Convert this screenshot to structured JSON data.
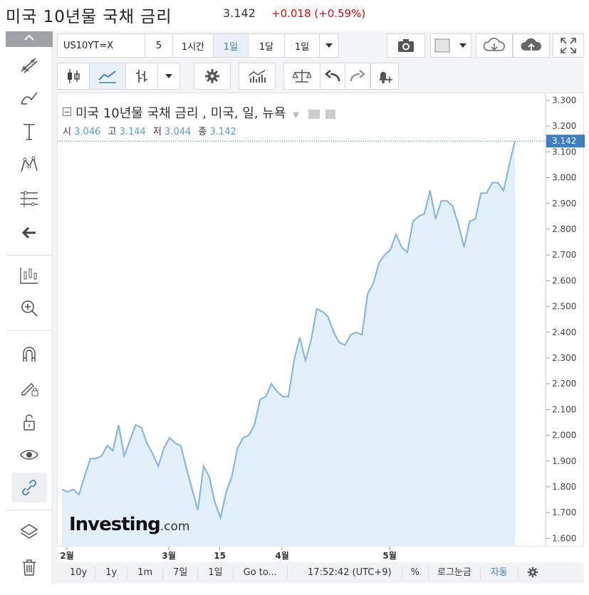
{
  "header": {
    "title": "미국 10년물 국채 금리",
    "price": "3.142",
    "change": "+0.018 (+0.59%)"
  },
  "toolbar": {
    "symbol": "US10YT=X",
    "intervals": [
      "5",
      "1시간",
      "1일",
      "1달",
      "1일"
    ],
    "active_interval": "1일"
  },
  "legend": {
    "title": "미국 10년물 국채 금리 , 미국, 일, 뉴욕",
    "o_label": "시",
    "o": "3.046",
    "h_label": "고",
    "h": "3.144",
    "l_label": "저",
    "l": "3.044",
    "c_label": "종",
    "c": "3.142"
  },
  "bottom": {
    "ranges": [
      "10y",
      "1y",
      "1m",
      "7일",
      "1일"
    ],
    "goto": "Go to...",
    "time": "17:52:42 (UTC+9)",
    "percent": "%",
    "log": "로그눈금",
    "auto": "자동"
  },
  "watermark": {
    "brand": "Investing",
    "suffix": ".com"
  },
  "colors": {
    "line": "#7fb2e5",
    "fill": "#e2f0fa",
    "accent": "#3d7fc1",
    "price_tag": "#3d7fc1",
    "up": "#e00000"
  },
  "chart_data": {
    "type": "area",
    "title": "미국 10년물 국채 금리 , 미국, 일, 뉴욕",
    "x_ticks": [
      {
        "label": "2월",
        "index": 1
      },
      {
        "label": "3월",
        "index": 19
      },
      {
        "label": "15",
        "index": 28
      },
      {
        "label": "4월",
        "index": 39
      },
      {
        "label": "5월",
        "index": 58
      }
    ],
    "y_ticks": [
      "3.300",
      "3.200",
      "3.100",
      "3.000",
      "2.900",
      "2.800",
      "2.700",
      "2.600",
      "2.500",
      "2.400",
      "2.300",
      "2.200",
      "2.100",
      "2.000",
      "1.900",
      "1.800",
      "1.700",
      "1.600"
    ],
    "ylim": [
      1.6,
      3.3
    ],
    "last_price_tag": "3.142",
    "values": [
      1.79,
      1.78,
      1.79,
      1.77,
      1.84,
      1.91,
      1.91,
      1.92,
      1.96,
      1.94,
      2.04,
      1.92,
      1.98,
      2.04,
      2.03,
      1.97,
      1.93,
      1.88,
      1.95,
      1.99,
      1.97,
      1.96,
      1.87,
      1.79,
      1.71,
      1.88,
      1.84,
      1.74,
      1.68,
      1.78,
      1.84,
      1.95,
      1.99,
      2.0,
      2.04,
      2.14,
      2.15,
      2.2,
      2.17,
      2.15,
      2.15,
      2.29,
      2.38,
      2.29,
      2.37,
      2.49,
      2.48,
      2.46,
      2.4,
      2.36,
      2.35,
      2.39,
      2.4,
      2.39,
      2.55,
      2.59,
      2.67,
      2.7,
      2.72,
      2.78,
      2.73,
      2.71,
      2.83,
      2.85,
      2.86,
      2.95,
      2.84,
      2.91,
      2.91,
      2.89,
      2.82,
      2.73,
      2.83,
      2.84,
      2.94,
      2.94,
      2.98,
      2.98,
      2.95,
      3.05,
      3.142
    ]
  }
}
